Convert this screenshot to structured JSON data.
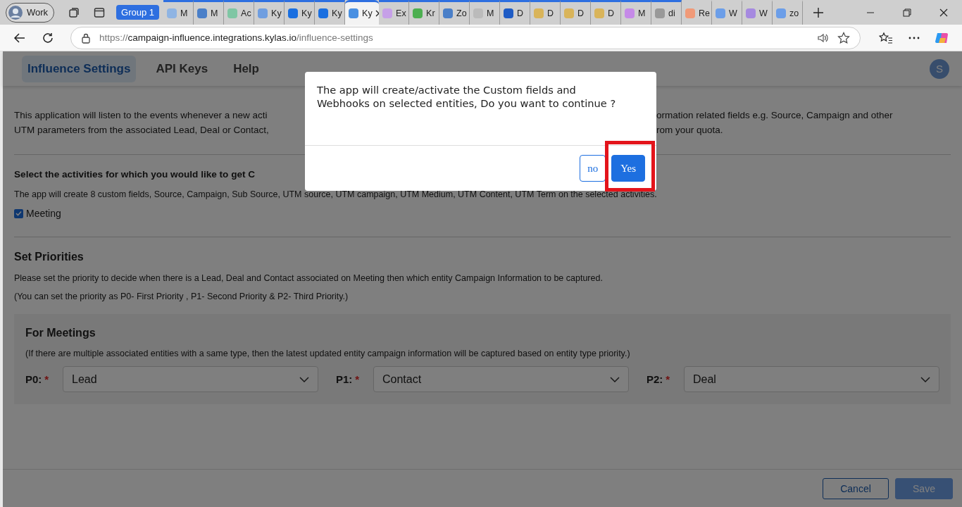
{
  "browser": {
    "profile": {
      "label": "Work"
    },
    "tab_group": {
      "label": "Group 1"
    },
    "tabs": [
      {
        "label": "M",
        "selected": false,
        "grouped": true
      },
      {
        "label": "M",
        "selected": false,
        "grouped": true
      },
      {
        "label": "Ac",
        "selected": false,
        "grouped": true
      },
      {
        "label": "Ky",
        "selected": false,
        "grouped": true
      },
      {
        "label": "Ky",
        "selected": false,
        "grouped": true
      },
      {
        "label": "Ky",
        "selected": false,
        "grouped": true
      },
      {
        "label": "Ky",
        "selected": true,
        "grouped": true
      },
      {
        "label": "Ex",
        "selected": false,
        "grouped": true
      },
      {
        "label": "Kr",
        "selected": false,
        "grouped": true
      },
      {
        "label": "Zo",
        "selected": false,
        "grouped": true
      },
      {
        "label": "M",
        "selected": false,
        "grouped": true
      },
      {
        "label": "D",
        "selected": false,
        "grouped": true
      },
      {
        "label": "D",
        "selected": false,
        "grouped": true
      },
      {
        "label": "D",
        "selected": false,
        "grouped": true
      },
      {
        "label": "D",
        "selected": false,
        "grouped": true
      },
      {
        "label": "M",
        "selected": false,
        "grouped": true
      },
      {
        "label": "di",
        "selected": false,
        "grouped": true
      },
      {
        "label": "Re",
        "selected": false,
        "grouped": false
      },
      {
        "label": "W",
        "selected": false,
        "grouped": false
      },
      {
        "label": "W",
        "selected": false,
        "grouped": false
      },
      {
        "label": "zo",
        "selected": false,
        "grouped": false
      }
    ],
    "url": {
      "scheme": "https://",
      "host": "campaign-influence.integrations.kylas.io",
      "path": "/influence-settings"
    }
  },
  "app": {
    "nav": [
      {
        "label": "Influence Settings",
        "selected": true
      },
      {
        "label": "API Keys",
        "selected": false
      },
      {
        "label": "Help",
        "selected": false
      }
    ],
    "avatar": "S"
  },
  "intro": {
    "lines": [
      {
        "left": "This application will listen to the events whenever a new acti",
        "right": "ormation related fields e.g. Source, Campaign and other"
      },
      {
        "left": "UTM parameters from the associated Lead, Deal or Contact,",
        "right": "rom your quota."
      }
    ]
  },
  "activities": {
    "heading": "Select the activities for which you would like to get C",
    "note": "The app will create 8 custom fields, Source, Campaign, Sub Source, UTM source, UTM campaign, UTM Medium, UTM Content, UTM Term on the selected activities.",
    "options": [
      {
        "label": "Meeting",
        "checked": true
      }
    ]
  },
  "priorities": {
    "heading": "Set Priorities",
    "text": "Please set the priority to decide when there is a Lead, Deal and Contact associated on Meeting then which entity Campaign Information to be captured.",
    "hint": "(You can set the priority as P0- First Priority , P1- Second Priority & P2- Third Priority.)",
    "panel": {
      "title": "For Meetings",
      "note": "(If there are multiple associated entities with a same type, then the latest updated entity campaign information will be captured based on entity type priority.)",
      "fields": [
        {
          "label": "P0:",
          "required_mark": "*",
          "value": "Lead"
        },
        {
          "label": "P1:",
          "required_mark": "*",
          "value": "Contact"
        },
        {
          "label": "P2:",
          "required_mark": "*",
          "value": "Deal"
        }
      ]
    }
  },
  "footer": {
    "buttons": [
      {
        "label": "Cancel",
        "kind": "secondary"
      },
      {
        "label": "Save",
        "kind": "primary"
      }
    ]
  },
  "dialog": {
    "message": "The app will create/activate the Custom fields and Webhooks on selected entities, Do you want to continue ?",
    "buttons": [
      {
        "label": "no",
        "kind": "secondary",
        "highlighted": false
      },
      {
        "label": "Yes",
        "kind": "primary",
        "highlighted": true
      }
    ]
  }
}
